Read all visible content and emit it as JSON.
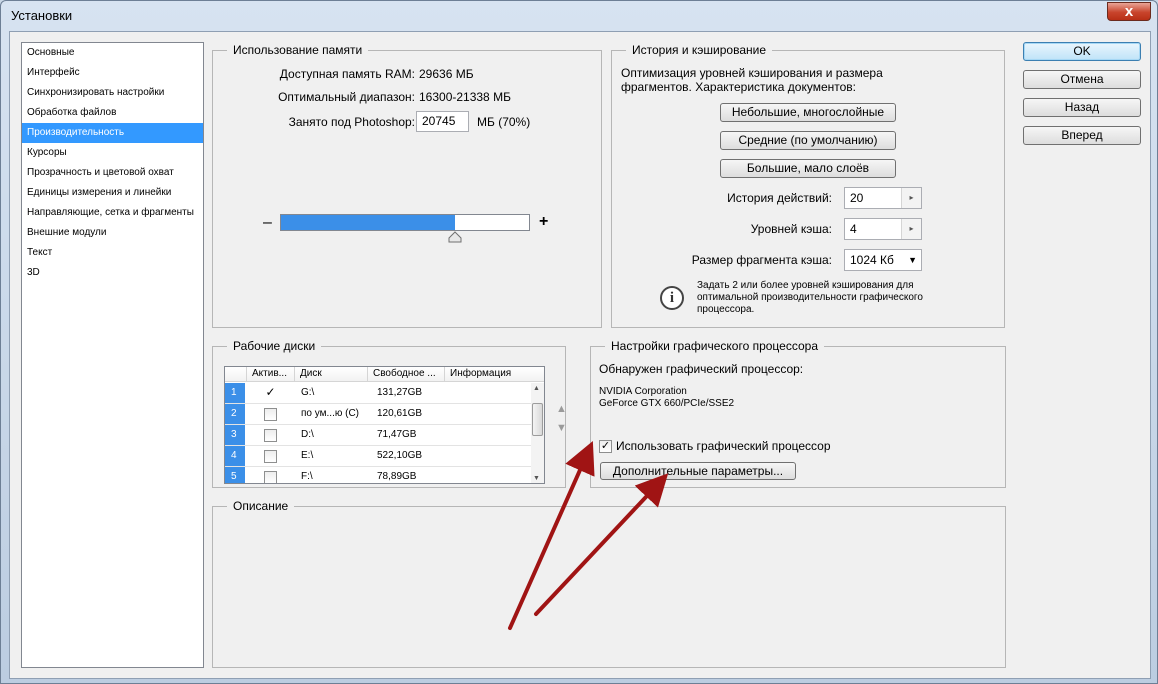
{
  "window": {
    "title": "Установки",
    "close_glyph": "x"
  },
  "sidebar": {
    "items": [
      {
        "label": "Основные"
      },
      {
        "label": "Интерфейс"
      },
      {
        "label": "Синхронизировать настройки"
      },
      {
        "label": "Обработка файлов"
      },
      {
        "label": "Производительность",
        "selected": true
      },
      {
        "label": "Курсоры"
      },
      {
        "label": "Прозрачность и цветовой охват"
      },
      {
        "label": "Единицы измерения и линейки"
      },
      {
        "label": "Направляющие, сетка и фрагменты"
      },
      {
        "label": "Внешние модули"
      },
      {
        "label": "Текст"
      },
      {
        "label": "3D"
      }
    ]
  },
  "memory": {
    "title": "Использование памяти",
    "available_label": "Доступная память RAM:",
    "available_value": "29636 МБ",
    "range_label": "Оптимальный диапазон:",
    "range_value": "16300-21338 МБ",
    "used_label": "Занято под Photoshop:",
    "used_value": "20745",
    "used_unit": "МБ (70%)",
    "minus": "–",
    "plus": "+",
    "slider_percent": 70
  },
  "history": {
    "title": "История и кэширование",
    "description": "Оптимизация уровней кэширования и размера фрагментов. Характеристика документов:",
    "preset_small": "Небольшие, многослойные",
    "preset_medium": "Средние (по умолчанию)",
    "preset_large": "Большие, мало слоёв",
    "states_label": "История действий:",
    "states_value": "20",
    "levels_label": "Уровней кэша:",
    "levels_value": "4",
    "tile_label": "Размер фрагмента кэша:",
    "tile_value": "1024 Кб",
    "hint": "Задать 2 или более уровней кэширования для оптимальной производительности графического процессора.",
    "info_glyph": "i"
  },
  "buttons": {
    "ok": "OK",
    "cancel": "Отмена",
    "prev": "Назад",
    "next": "Вперед"
  },
  "disks": {
    "title": "Рабочие диски",
    "columns": [
      "Актив...",
      "Диск",
      "Свободное ...",
      "Информация"
    ],
    "rows": [
      {
        "num": "1",
        "active": true,
        "disk": "G:\\",
        "free": "131,27GB",
        "info": ""
      },
      {
        "num": "2",
        "active": false,
        "disk": "по ум...ю (C)",
        "free": "120,61GB",
        "info": ""
      },
      {
        "num": "3",
        "active": false,
        "disk": "D:\\",
        "free": "71,47GB",
        "info": ""
      },
      {
        "num": "4",
        "active": false,
        "disk": "E:\\",
        "free": "522,10GB",
        "info": ""
      },
      {
        "num": "5",
        "active": false,
        "disk": "F:\\",
        "free": "78,89GB",
        "info": ""
      }
    ],
    "check_glyph": "✓",
    "move_up_glyph": "▲",
    "move_down_glyph": "▼"
  },
  "gpu": {
    "title": "Настройки графического процессора",
    "detected_label": "Обнаружен графический процессор:",
    "vendor": "NVIDIA Corporation",
    "model": "GeForce GTX 660/PCIe/SSE2",
    "use_label": "Использовать графический процессор",
    "use_checked": true,
    "advanced_button": "Дополнительные параметры..."
  },
  "description": {
    "title": "Описание",
    "text": ""
  },
  "colors": {
    "selection": "#3399ff",
    "slider_fill": "#3b8fe8",
    "annotation_arrow": "#a01414"
  }
}
